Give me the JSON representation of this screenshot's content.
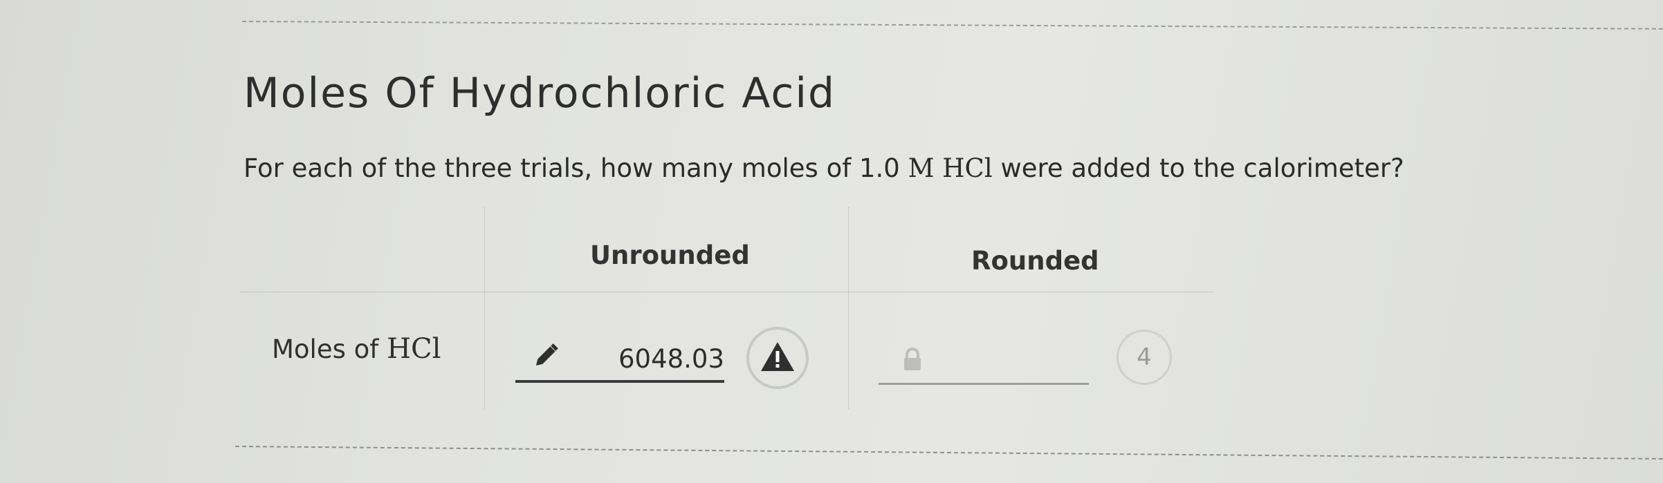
{
  "title": "Moles Of Hydrochloric Acid",
  "question": {
    "prefix": "For each of the three trials, how many moles of",
    "concentration": "1.0",
    "unit": "M HCl",
    "suffix": "were added to the calorimeter?"
  },
  "table": {
    "headers": {
      "unrounded": "Unrounded",
      "rounded": "Rounded"
    },
    "row": {
      "label_prefix": "Moles of",
      "label_formula": "HCl",
      "unrounded_value": "6048.03",
      "rounded_value": "",
      "attempts": "4"
    }
  },
  "icons": {
    "edit": "pencil-icon",
    "warning": "warning-icon",
    "locked": "lock-icon"
  },
  "colors": {
    "text": "#2b2b2b",
    "muted": "#9a9a98",
    "warning_bg": "#2f2f2f"
  }
}
